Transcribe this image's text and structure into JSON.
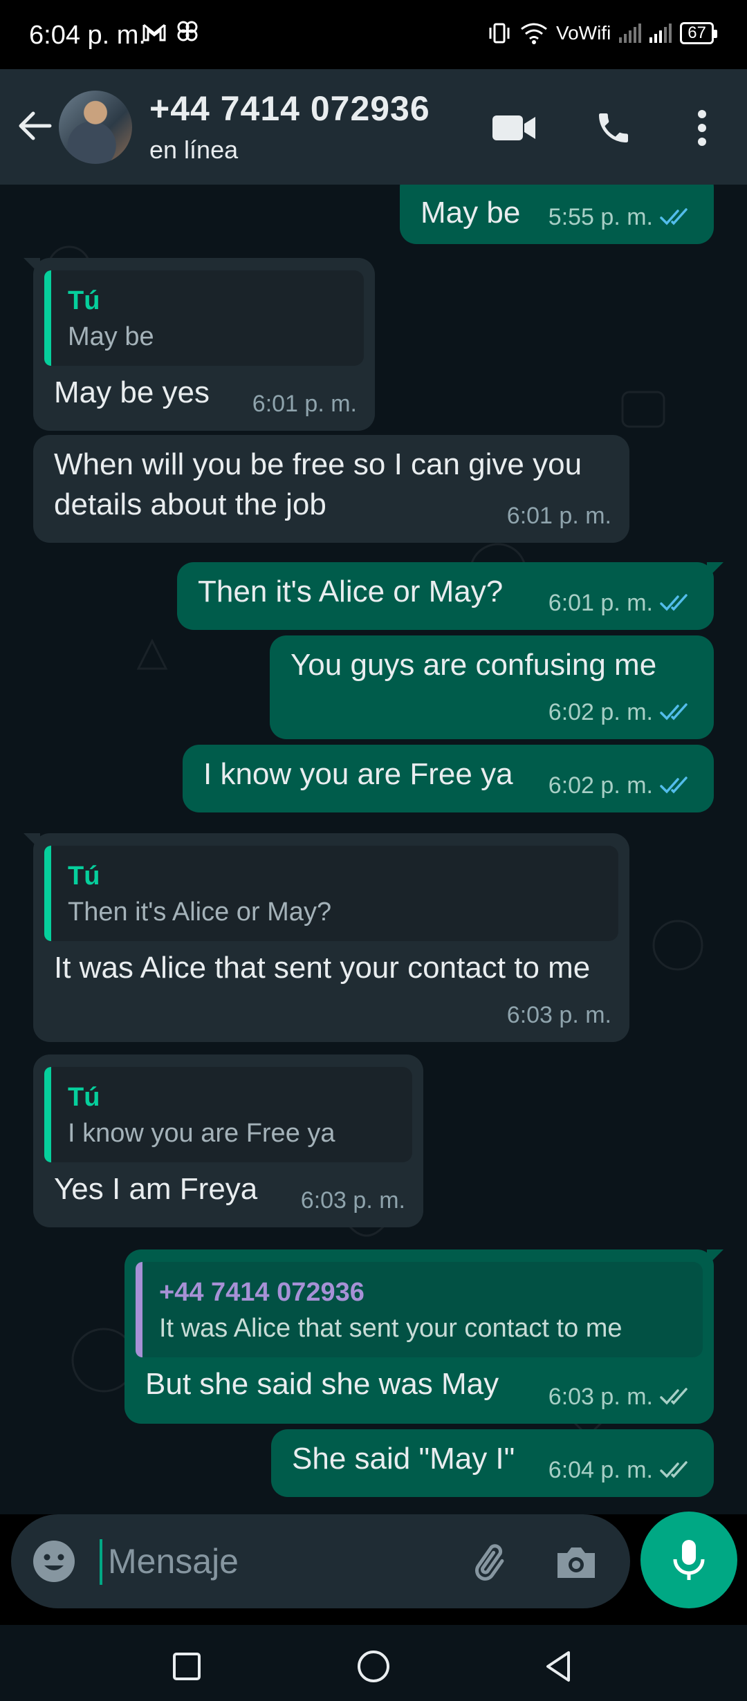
{
  "status_bar": {
    "time": "6:04 p. m.",
    "left_icons": [
      "gmail-icon",
      "pinwheel-icon"
    ],
    "vowifi": "VoWifi",
    "battery": "67"
  },
  "header": {
    "contact_name": "+44 7414 072936",
    "status": "en línea"
  },
  "messages": [
    {
      "dir": "out",
      "text": "May be",
      "time": "5:55 p. m.",
      "status": "read"
    },
    {
      "dir": "in",
      "quote_author": "Tú",
      "quote_text": "May be",
      "text": "May be yes",
      "time": "6:01 p. m."
    },
    {
      "dir": "in",
      "text": "When will you be free so I can give you details about the job",
      "time": "6:01 p. m."
    },
    {
      "dir": "out",
      "text": "Then it's Alice or May?",
      "time": "6:01 p. m.",
      "status": "read"
    },
    {
      "dir": "out",
      "text": "You guys are confusing me",
      "time": "6:02 p. m.",
      "status": "read"
    },
    {
      "dir": "out",
      "text": "I know you are Free ya",
      "time": "6:02 p. m.",
      "status": "read"
    },
    {
      "dir": "in",
      "quote_author": "Tú",
      "quote_text": "Then it's Alice or May?",
      "text": "It was Alice that sent your contact to me",
      "time": "6:03 p. m."
    },
    {
      "dir": "in",
      "quote_author": "Tú",
      "quote_text": "I know you are Free ya",
      "text": "Yes I am Freya",
      "time": "6:03 p. m."
    },
    {
      "dir": "out",
      "quote_author": "+44 7414 072936",
      "quote_text": "It was Alice that sent your contact to me",
      "text": "But she said she was May",
      "time": "6:03 p. m.",
      "status": "delivered"
    },
    {
      "dir": "out",
      "text": "She said \"May I\"",
      "time": "6:04 p. m.",
      "status": "delivered"
    }
  ],
  "composer": {
    "placeholder": "Mensaje"
  },
  "colors": {
    "header_bg": "#1f2c34",
    "chat_bg": "#0b141a",
    "incoming_bubble": "#202c33",
    "outgoing_bubble": "#005c4b",
    "accent": "#00a884",
    "read_ticks": "#53bdeb"
  },
  "icons": {
    "back": "arrow-left-icon",
    "video": "video-call-icon",
    "call": "phone-icon",
    "menu": "more-vertical-icon",
    "emoji": "emoji-icon",
    "attach": "paperclip-icon",
    "camera": "camera-icon",
    "mic": "microphone-icon"
  }
}
